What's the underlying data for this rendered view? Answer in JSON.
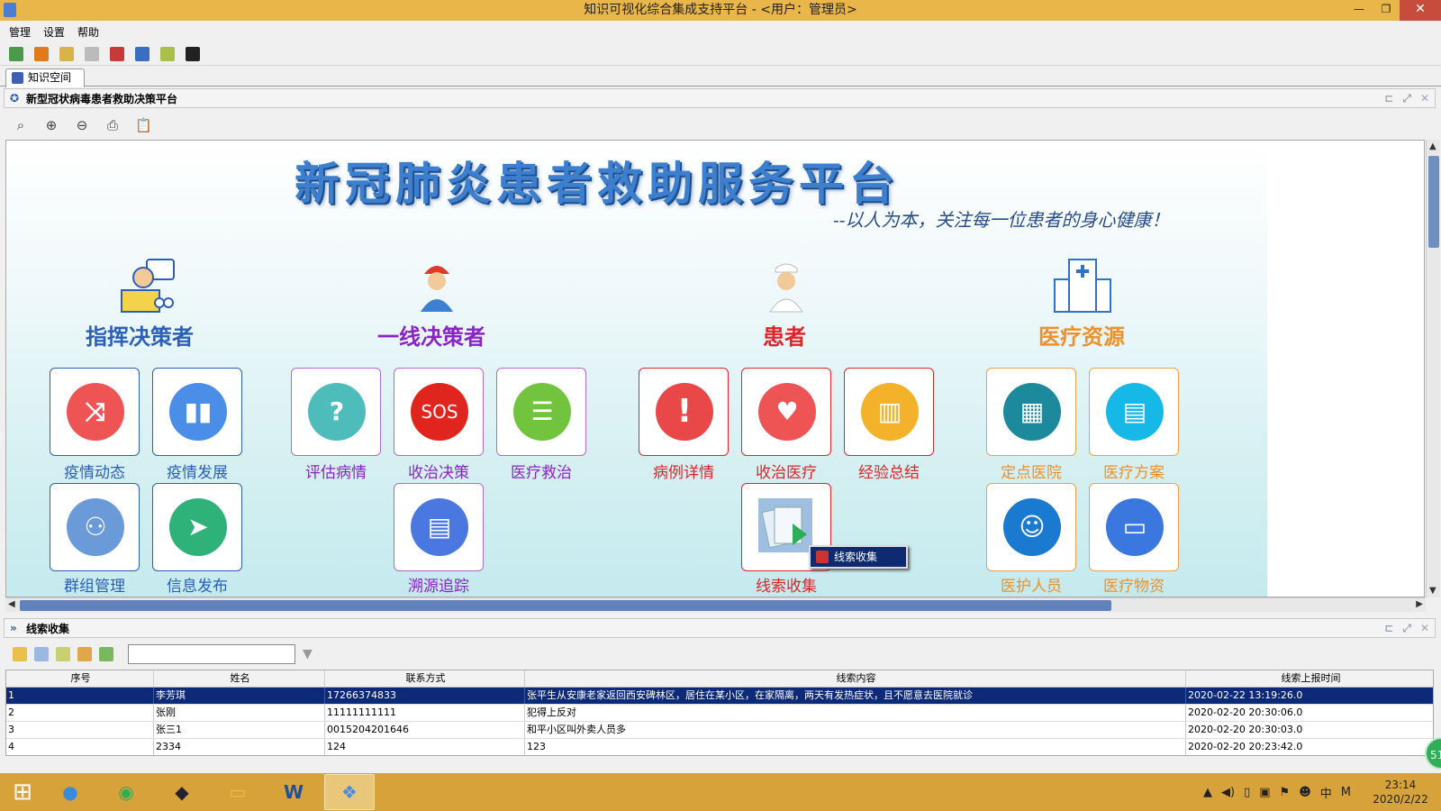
{
  "window": {
    "title": "知识可视化综合集成支持平台 - <用户：管理员>"
  },
  "menu": [
    "管理",
    "设置",
    "帮助"
  ],
  "tab": {
    "label": "知识空间"
  },
  "panel1": {
    "title": "新型冠状病毒患者救助决策平台"
  },
  "banner": {
    "title": "新冠肺炎患者救助服务平台",
    "slogan": "--以人为本，关注每一位患者的身心健康！"
  },
  "categories": [
    {
      "name": "指挥决策者",
      "color": "#2b5fb8"
    },
    {
      "name": "一线决策者",
      "color": "#8a24c6"
    },
    {
      "name": "患者",
      "color": "#e0242a"
    },
    {
      "name": "医疗资源",
      "color": "#f0902a"
    }
  ],
  "tiles": {
    "t1": "疫情动态",
    "t2": "疫情发展",
    "t3": "群组管理",
    "t4": "信息发布",
    "t5": "评估病情",
    "t6": "收治决策",
    "t7": "医疗救治",
    "t8": "溯源追踪",
    "t9": "病例详情",
    "t10": "收治医疗",
    "t11": "经验总结",
    "t12": "线索收集",
    "t13": "定点医院",
    "t14": "医疗方案",
    "t15": "医护人员",
    "t16": "医疗物资"
  },
  "sos_text": "SOS",
  "popup": {
    "label": "线索收集"
  },
  "panel2": {
    "title": "线索收集"
  },
  "search": {
    "value": ""
  },
  "table": {
    "headers": [
      "序号",
      "姓名",
      "联系方式",
      "线索内容",
      "线索上报时间"
    ],
    "rows": [
      [
        "1",
        "李芳琪",
        "17266374833",
        "张平生从安康老家返回西安碑林区，居住在某小区，在家隔离，两天有发热症状，且不愿意去医院就诊",
        "2020-02-22 13:19:26.0"
      ],
      [
        "2",
        "张刚",
        "11111111111",
        "犯得上反对",
        "2020-02-20 20:30:06.0"
      ],
      [
        "3",
        "张三1",
        "0015204201646",
        "和平小区叫外卖人员多",
        "2020-02-20 20:30:03.0"
      ],
      [
        "4",
        "2334",
        "124",
        "123",
        "2020-02-20 20:23:42.0"
      ]
    ]
  },
  "badge": "51",
  "tray": {
    "ime": "中",
    "m": "M",
    "time": "23:14",
    "date": "2020/2/22"
  }
}
